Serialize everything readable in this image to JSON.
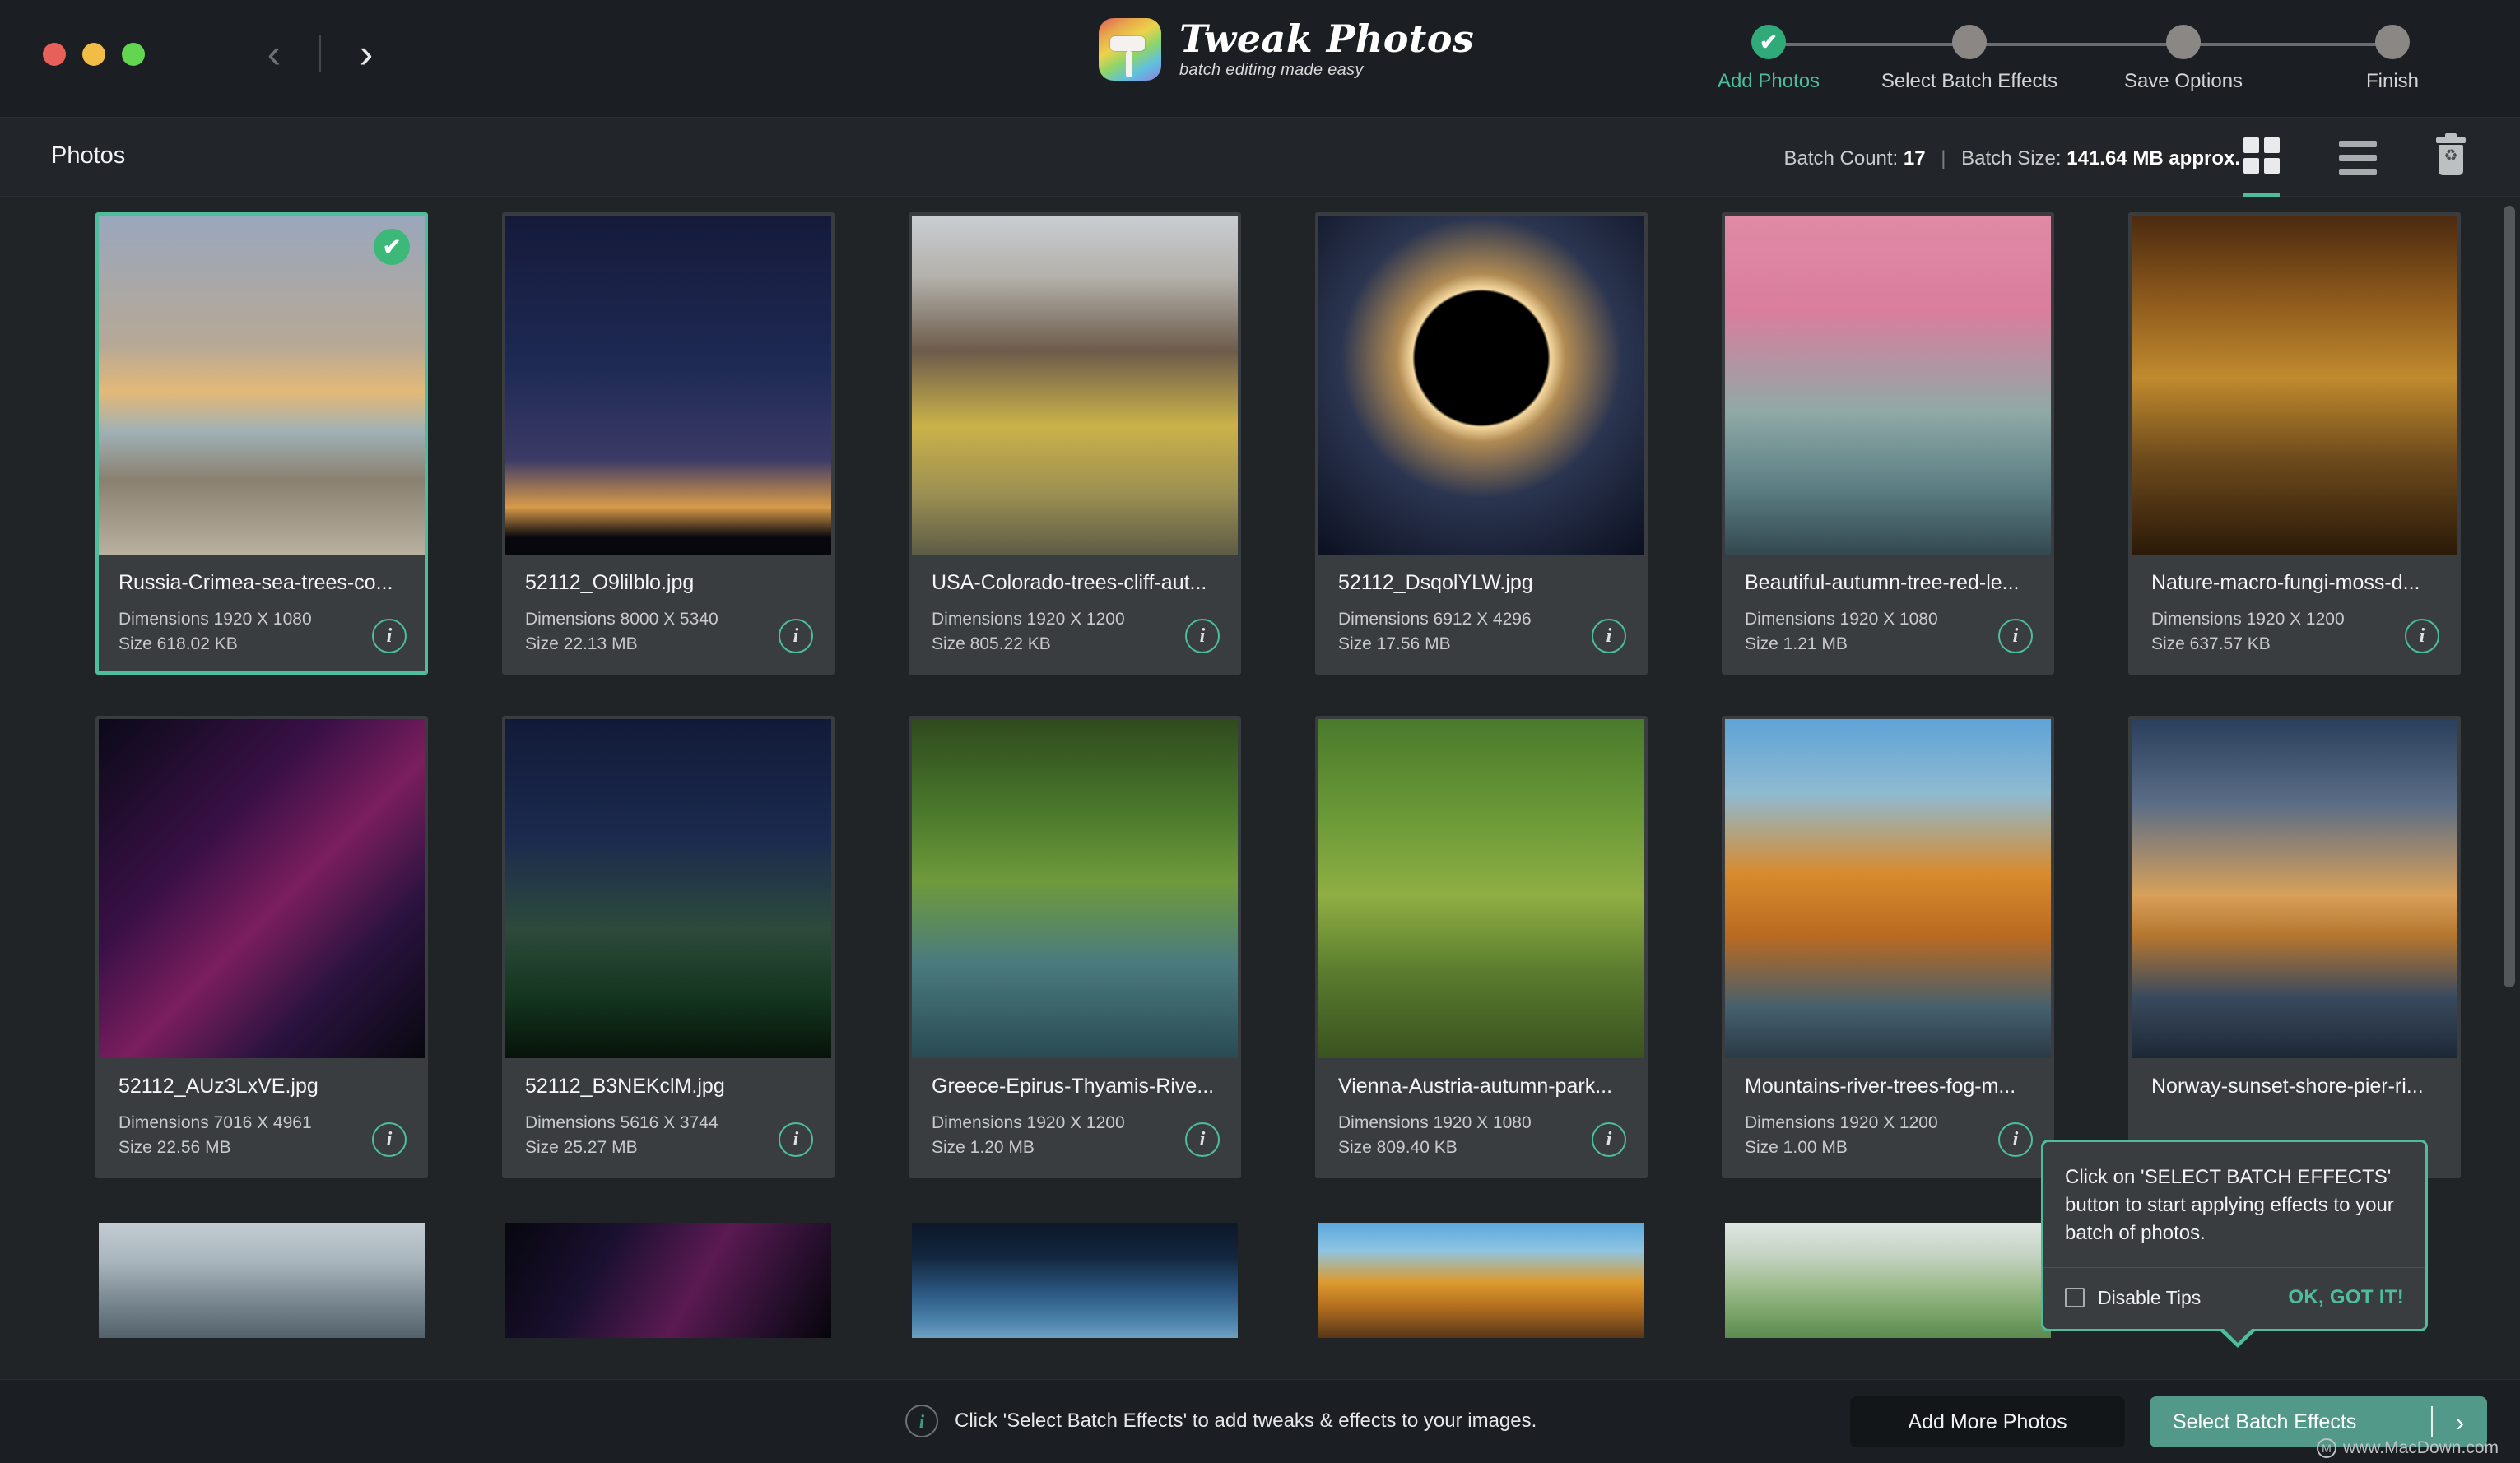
{
  "window": {
    "traffic_lights": [
      "close",
      "minimize",
      "maximize"
    ],
    "nav_back": "‹",
    "nav_forward": "›"
  },
  "brand": {
    "title": "Tweak Photos",
    "tagline": "batch editing made easy",
    "icon": "paint-roller-app-icon"
  },
  "steps": [
    {
      "label": "Add Photos",
      "state": "done",
      "check": "✔"
    },
    {
      "label": "Select Batch Effects",
      "state": "pending",
      "check": ""
    },
    {
      "label": "Save Options",
      "state": "pending",
      "check": ""
    },
    {
      "label": "Finish",
      "state": "pending",
      "check": ""
    }
  ],
  "subheader": {
    "page_title": "Photos",
    "batch_count_label": "Batch Count:",
    "batch_count_value": "17",
    "separator": "|",
    "batch_size_label": "Batch Size:",
    "batch_size_value": "141.64 MB approx.",
    "tools": [
      {
        "name": "grid-view",
        "active": true
      },
      {
        "name": "list-view",
        "active": false
      },
      {
        "name": "delete",
        "active": false
      }
    ]
  },
  "grid": {
    "dimensions_prefix": "Dimensions",
    "size_prefix": "Size",
    "info_glyph": "i",
    "photos": [
      {
        "name": "Russia-Crimea-sea-trees-co...",
        "dimensions": "Dimensions 1920 X 1080",
        "size": "Size 618.02 KB",
        "selected": true,
        "art": "tb-crimea"
      },
      {
        "name": "52112_O9lilblo.jpg",
        "dimensions": "Dimensions 8000 X 5340",
        "size": "Size 22.13 MB",
        "selected": false,
        "art": "tb-stars"
      },
      {
        "name": "USA-Colorado-trees-cliff-aut...",
        "dimensions": "Dimensions 1920 X 1200",
        "size": "Size 805.22 KB",
        "selected": false,
        "art": "tb-cliff"
      },
      {
        "name": "52112_DsqolYLW.jpg",
        "dimensions": "Dimensions 6912 X 4296",
        "size": "Size 17.56 MB",
        "selected": false,
        "art": "tb-eclipse"
      },
      {
        "name": "Beautiful-autumn-tree-red-le...",
        "dimensions": "Dimensions 1920 X 1080",
        "size": "Size 1.21 MB",
        "selected": false,
        "art": "tb-sakura"
      },
      {
        "name": "Nature-macro-fungi-moss-d...",
        "dimensions": "Dimensions 1920 X 1200",
        "size": "Size 637.57 KB",
        "selected": false,
        "art": "tb-fungi"
      },
      {
        "name": "52112_AUz3LxVE.jpg",
        "dimensions": "Dimensions 7016 X 4961",
        "size": "Size 22.56 MB",
        "selected": false,
        "art": "tb-nebula"
      },
      {
        "name": "52112_B3NEKclM.jpg",
        "dimensions": "Dimensions 5616 X 3744",
        "size": "Size 25.27 MB",
        "selected": false,
        "art": "tb-night"
      },
      {
        "name": "Greece-Epirus-Thyamis-Rive...",
        "dimensions": "Dimensions 1920 X 1200",
        "size": "Size 1.20 MB",
        "selected": false,
        "art": "tb-river"
      },
      {
        "name": "Vienna-Austria-autumn-park...",
        "dimensions": "Dimensions 1920 X 1080",
        "size": "Size 809.40 KB",
        "selected": false,
        "art": "tb-vienna"
      },
      {
        "name": "Mountains-river-trees-fog-m...",
        "dimensions": "Dimensions 1920 X 1200",
        "size": "Size 1.00 MB",
        "selected": false,
        "art": "tb-autumn"
      },
      {
        "name": "Norway-sunset-shore-pier-ri...",
        "dimensions": "",
        "size": "",
        "selected": false,
        "art": "tb-pier"
      }
    ],
    "partial_row": [
      {
        "art": "tb-fog"
      },
      {
        "art": "tb-galaxy"
      },
      {
        "art": "tb-pine"
      },
      {
        "art": "tb-fall"
      },
      {
        "art": "tb-hills"
      }
    ]
  },
  "tip": {
    "text": "Click on 'SELECT BATCH EFFECTS' button to start applying effects to your batch of photos.",
    "disable_label": "Disable Tips",
    "ok_label": "OK, GOT IT!",
    "checkbox_checked": false
  },
  "bottom": {
    "hint": "Click 'Select Batch Effects' to add tweaks & effects to your images.",
    "hint_icon_glyph": "i",
    "add_more_label": "Add More Photos",
    "select_effects_label": "Select Batch Effects",
    "select_effects_chevron": "›",
    "watermark": "www.MacDown.com",
    "watermark_mark": "M"
  },
  "colors": {
    "accent_teal": "#4dbd9b",
    "accent_button": "#53998a",
    "check_green": "#3cb878",
    "background": "#212427",
    "card": "#3a3d40"
  }
}
